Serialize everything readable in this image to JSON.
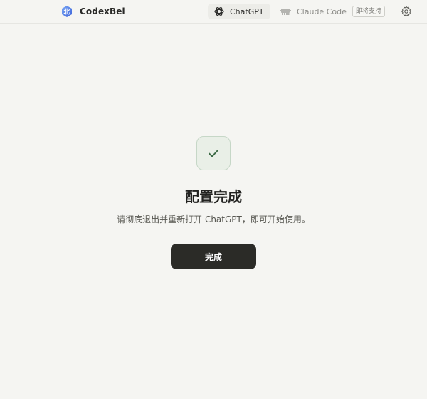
{
  "header": {
    "brand_name": "CodexBei",
    "tabs": [
      {
        "label": "ChatGPT",
        "icon": "openai-icon",
        "active": true
      },
      {
        "label": "Claude Code",
        "icon": "claude-icon",
        "active": false,
        "badge": "即将支持"
      }
    ],
    "settings_icon": "gear-icon"
  },
  "main": {
    "status_icon": "check-icon",
    "title": "配置完成",
    "subtitle": "请彻底退出并重新打开 ChatGPT，即可开始使用。",
    "button_label": "完成"
  },
  "colors": {
    "background": "#f5f5f2",
    "button": "#2b2b27",
    "success_bg": "#e9efe7",
    "success_check": "#3d6b47"
  }
}
